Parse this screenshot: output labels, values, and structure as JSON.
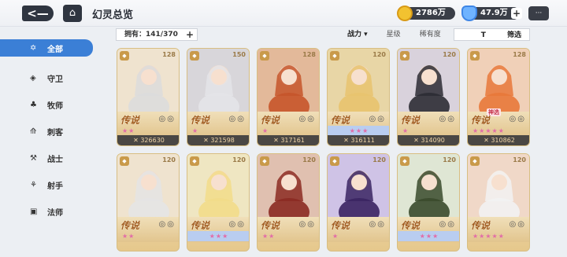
{
  "topbar": {
    "back_label": "<—",
    "home_label": "⌂",
    "title": "幻灵总览",
    "gold": "2786万",
    "diamond": "47.9万",
    "plus": "+",
    "chat_label": "···"
  },
  "sidebar": {
    "items": [
      {
        "label": "全部",
        "icon": "✡",
        "active": true
      },
      {
        "label": "守卫",
        "icon": "◈"
      },
      {
        "label": "牧师",
        "icon": "♣"
      },
      {
        "label": "刺客",
        "icon": "⟰"
      },
      {
        "label": "战士",
        "icon": "⚒"
      },
      {
        "label": "射手",
        "icon": "⚘"
      },
      {
        "label": "法师",
        "icon": "▣"
      }
    ]
  },
  "filterbar": {
    "owned": "拥有：141/370",
    "plus": "+",
    "sort_power": "战力 ▾",
    "sort_star": "星级",
    "sort_rarity": "稀有度",
    "filter_btn": "筛选",
    "filter_icon": "T"
  },
  "cards": [
    {
      "level": "128",
      "rarity": "传说",
      "stars": "★★",
      "power": "✕ 326630",
      "blue": false,
      "tag": "",
      "badges": "◎◎"
    },
    {
      "level": "150",
      "rarity": "传说",
      "stars": "★",
      "power": "✕ 321598",
      "blue": false,
      "tag": "",
      "badges": "◎◎"
    },
    {
      "level": "128",
      "rarity": "传说",
      "stars": "★",
      "power": "✕ 317161",
      "blue": false,
      "tag": "",
      "badges": "◎◎"
    },
    {
      "level": "120",
      "rarity": "传说",
      "stars": "★★★",
      "power": "✕ 316111",
      "blue": true,
      "tag": "",
      "badges": "◎◎"
    },
    {
      "level": "120",
      "rarity": "传说",
      "stars": "★",
      "power": "✕ 314090",
      "blue": false,
      "tag": "",
      "badges": "◎◎"
    },
    {
      "level": "128",
      "rarity": "传说",
      "stars": "★★★★★",
      "power": "✕ 310862",
      "blue": false,
      "tag": "神选",
      "badges": "◎◎"
    },
    {
      "level": "120",
      "rarity": "传说",
      "stars": "★★",
      "power": "",
      "blue": false,
      "tag": "",
      "badges": "◎◎"
    },
    {
      "level": "120",
      "rarity": "传说",
      "stars": "★★★",
      "power": "",
      "blue": true,
      "tag": "",
      "badges": "◎◎"
    },
    {
      "level": "120",
      "rarity": "传说",
      "stars": "★★",
      "power": "",
      "blue": false,
      "tag": "",
      "badges": "◎◎"
    },
    {
      "level": "120",
      "rarity": "传说",
      "stars": "★",
      "power": "",
      "blue": false,
      "tag": "",
      "badges": "◎◎"
    },
    {
      "level": "120",
      "rarity": "传说",
      "stars": "★★★",
      "power": "",
      "blue": true,
      "tag": "",
      "badges": "◎◎"
    },
    {
      "level": "120",
      "rarity": "传说",
      "stars": "★★★★★",
      "power": "",
      "blue": false,
      "tag": "",
      "badges": "◎◎"
    }
  ],
  "colors": {
    "accent": "#3b7fd6",
    "card_gold": "#e6c88c",
    "power_bar": "#4a4744"
  }
}
